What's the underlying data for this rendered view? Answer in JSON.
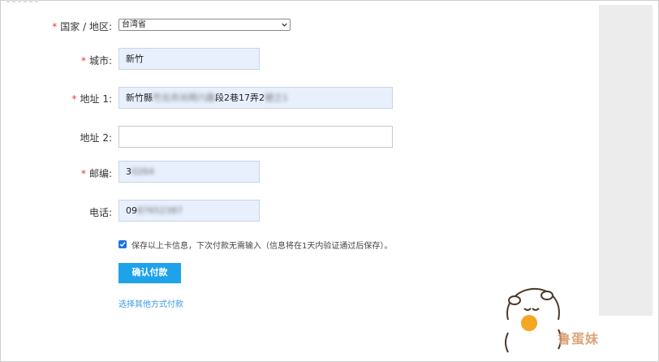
{
  "form": {
    "country": {
      "label": "国家 / 地区:",
      "value": "台湾省"
    },
    "city": {
      "label": "城市:",
      "value": "新竹"
    },
    "address1": {
      "label": "地址 1:",
      "visible_prefix": "新竹縣",
      "obscured_a": "竹北市光明六路",
      "visible_mid": "段2巷17弄2",
      "obscured_b": "號之1"
    },
    "address2": {
      "label": "地址 2:",
      "value": ""
    },
    "zip": {
      "label": "邮编:",
      "visible": "3",
      "obscured": "0264"
    },
    "phone": {
      "label": "电话:",
      "visible": "09",
      "obscured": "87652387"
    },
    "required_mark": "*"
  },
  "save_card": {
    "checked": true,
    "text": "保存以上卡信息，下次付款无需输入（信息将在1天内验证通过后保存）。"
  },
  "confirm_button": {
    "label": "确认付款"
  },
  "other_payment": {
    "label": "选择其他方式付款"
  },
  "watermark": {
    "text": "鲁蛋妹"
  },
  "colors": {
    "accent": "#1ea2ea",
    "field_fill": "#e8f0fe",
    "required": "#e33b3b",
    "link": "#3a9be0"
  }
}
